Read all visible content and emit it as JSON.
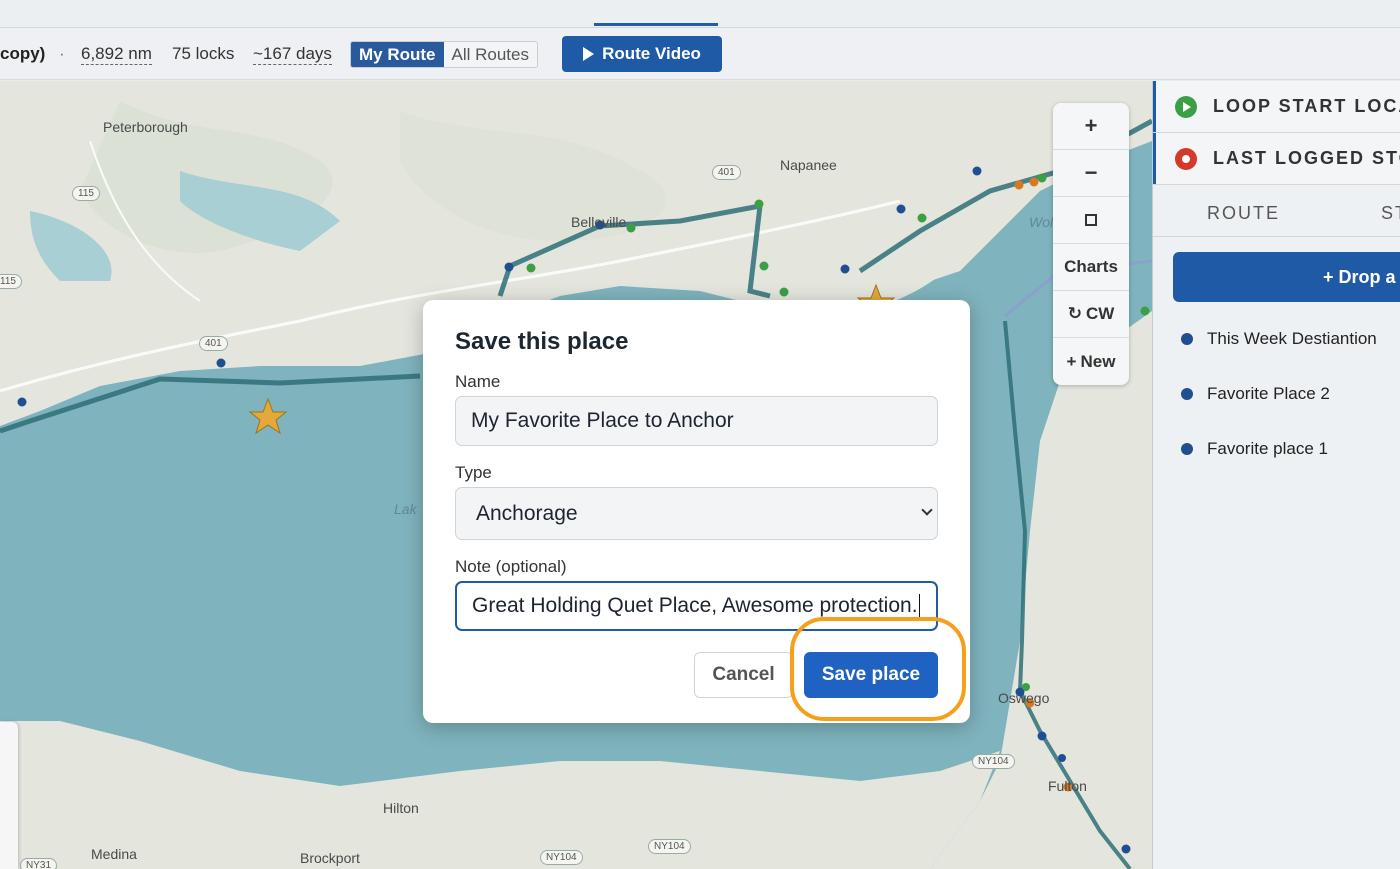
{
  "stats": {
    "title_fragment": "copy)",
    "separator": "·",
    "distance": "6,892 nm",
    "locks": "75 locks",
    "duration": "~167 days"
  },
  "route_toggle": {
    "mine": "My Route",
    "all": "All Routes"
  },
  "route_video_label": "Route Video",
  "map": {
    "labels": {
      "peterborough": "Peterborough",
      "napanee": "Napanee",
      "belleville": "Belleville",
      "lake": "Lak",
      "wolfe": "Wol",
      "oswego": "Oswego",
      "fulton": "Fulton",
      "hilton": "Hilton",
      "brockport": "Brockport",
      "medina": "Medina"
    },
    "shields": {
      "s115a": "115",
      "s115b": "115",
      "s401a": "401",
      "s401b": "401",
      "ny104a": "NY104",
      "ny104b": "NY104",
      "ny104c": "NY104",
      "ny31": "NY31"
    },
    "controls": {
      "zoom_in": "+",
      "zoom_out": "−",
      "charts": "Charts",
      "cw": "CW",
      "new": "New"
    }
  },
  "sidebar": {
    "loop_start": "LOOP START LOCA",
    "last_logged": "LAST LOGGED STO",
    "tab_route": "ROUTE",
    "tab_st": "ST",
    "drop_button": "+ Drop a",
    "places": [
      "This Week Destiantion",
      "Favorite Place 2",
      "Favorite place 1"
    ]
  },
  "modal": {
    "title": "Save this place",
    "name_label": "Name",
    "name_value": "My Favorite Place to Anchor",
    "type_label": "Type",
    "type_value": "Anchorage",
    "note_label": "Note (optional)",
    "note_value": "Great Holding Quet Place, Awesome protection.",
    "cancel": "Cancel",
    "save": "Save place"
  },
  "colors": {
    "primary": "#1f5aa6",
    "water": "#7fb3bd",
    "land": "#e6e8e1",
    "route": "#2f6e78",
    "highlight": "#f5a01a"
  }
}
